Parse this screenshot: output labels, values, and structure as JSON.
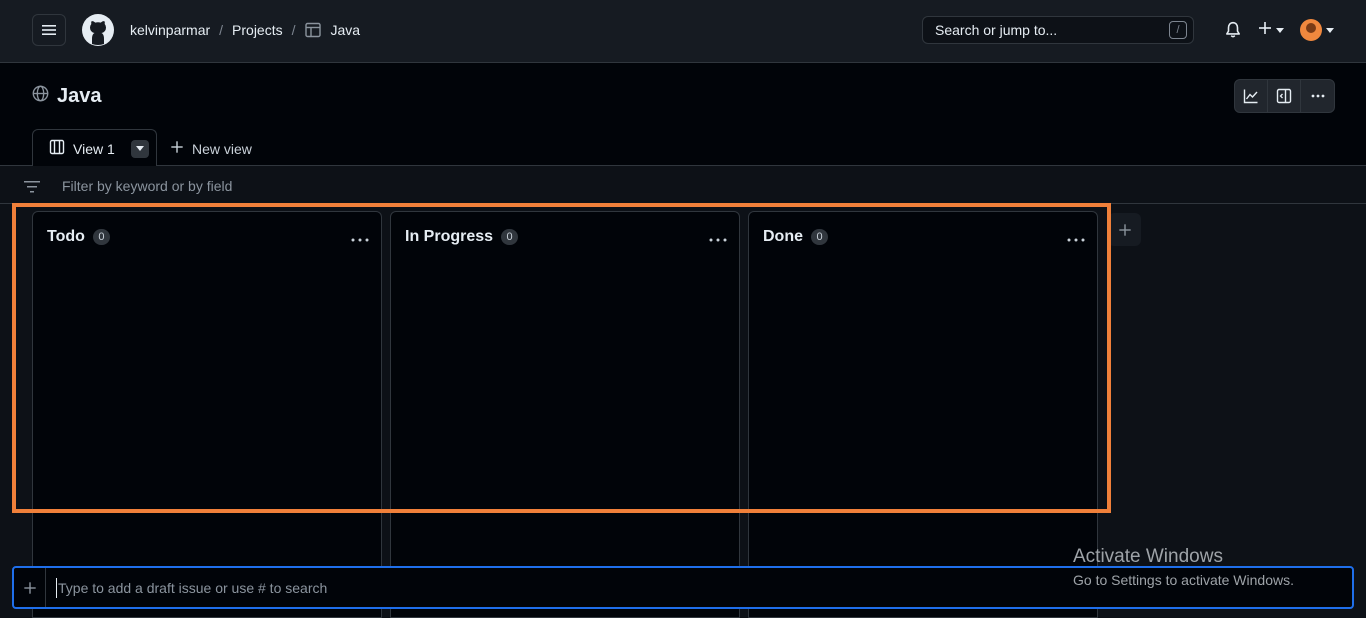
{
  "header": {
    "breadcrumb": {
      "user": "kelvinparmar",
      "projects": "Projects",
      "project": "Java",
      "separator": "/"
    },
    "search": {
      "placeholder": "Search or jump to...",
      "shortcut": "/"
    }
  },
  "project": {
    "title": "Java"
  },
  "tabs": [
    {
      "label": "View 1"
    }
  ],
  "new_view_label": "New view",
  "filter": {
    "placeholder": "Filter by keyword or by field"
  },
  "columns": [
    {
      "name": "Todo",
      "count": "0"
    },
    {
      "name": "In Progress",
      "count": "0"
    },
    {
      "name": "Done",
      "count": "0"
    }
  ],
  "draft": {
    "placeholder": "Type to add a draft issue or use # to search"
  },
  "watermark": {
    "title": "Activate Windows",
    "subtitle": "Go to Settings to activate Windows."
  },
  "colors": {
    "highlight": "#f0803a",
    "focus": "#1f6feb",
    "bg": "#010409"
  },
  "icons": [
    "hamburger-icon",
    "github-logo-icon",
    "table-icon",
    "bell-icon",
    "plus-icon",
    "globe-icon",
    "insights-icon",
    "side-panel-icon",
    "kebab-icon",
    "board-icon",
    "filter-icon"
  ]
}
